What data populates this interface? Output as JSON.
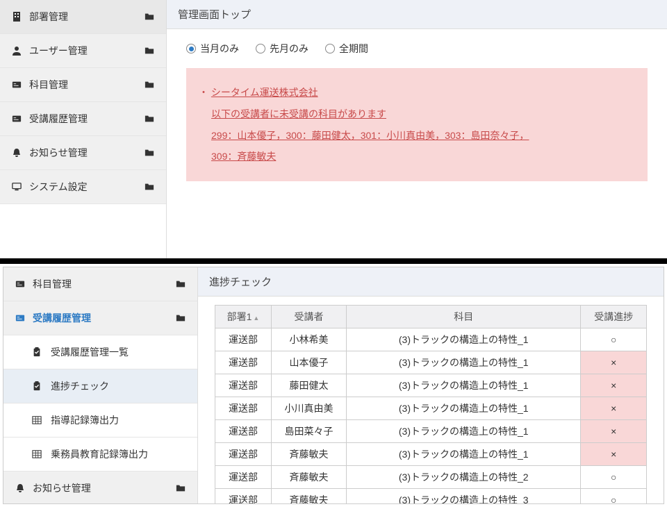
{
  "top": {
    "sidebar": [
      {
        "icon": "building",
        "label": "部署管理"
      },
      {
        "icon": "user",
        "label": "ユーザー管理"
      },
      {
        "icon": "card",
        "label": "科目管理"
      },
      {
        "icon": "card",
        "label": "受講履歴管理"
      },
      {
        "icon": "bell",
        "label": "お知らせ管理"
      },
      {
        "icon": "monitor",
        "label": "システム設定"
      }
    ],
    "page_title": "管理画面トップ",
    "radios": [
      {
        "label": "当月のみ",
        "selected": true
      },
      {
        "label": "先月のみ",
        "selected": false
      },
      {
        "label": "全期間",
        "selected": false
      }
    ],
    "alert": {
      "company": "シータイム運送株式会社",
      "line1": "以下の受講者に未受講の科目があります",
      "line2": "299：山本優子，300：藤田健太，301：小川真由美，303：島田奈々子，",
      "line3": "309：斉藤敏夫"
    }
  },
  "bottom": {
    "sidebar": {
      "item_subject": "科目管理",
      "item_history": "受講履歴管理",
      "sub_list": "受講履歴管理一覧",
      "sub_progress": "進捗チェック",
      "sub_export1": "指導記録簿出力",
      "sub_export2": "乗務員教育記録簿出力",
      "item_notice": "お知らせ管理"
    },
    "page_title": "進捗チェック",
    "table": {
      "headers": {
        "dept": "部署1",
        "user": "受講者",
        "subject": "科目",
        "progress": "受講進捗"
      },
      "rows": [
        {
          "dept": "運送部",
          "user": "小林希美",
          "subject": "(3)トラックの構造上の特性_1",
          "progress": "○",
          "fail": false
        },
        {
          "dept": "運送部",
          "user": "山本優子",
          "subject": "(3)トラックの構造上の特性_1",
          "progress": "×",
          "fail": true
        },
        {
          "dept": "運送部",
          "user": "藤田健太",
          "subject": "(3)トラックの構造上の特性_1",
          "progress": "×",
          "fail": true
        },
        {
          "dept": "運送部",
          "user": "小川真由美",
          "subject": "(3)トラックの構造上の特性_1",
          "progress": "×",
          "fail": true
        },
        {
          "dept": "運送部",
          "user": "島田菜々子",
          "subject": "(3)トラックの構造上の特性_1",
          "progress": "×",
          "fail": true
        },
        {
          "dept": "運送部",
          "user": "斉藤敏夫",
          "subject": "(3)トラックの構造上の特性_1",
          "progress": "×",
          "fail": true
        },
        {
          "dept": "運送部",
          "user": "斉藤敏夫",
          "subject": "(3)トラックの構造上の特性_2",
          "progress": "○",
          "fail": false
        },
        {
          "dept": "運送部",
          "user": "斉藤敏夫",
          "subject": "(3)トラックの構造上の特性_3",
          "progress": "○",
          "fail": false
        }
      ]
    }
  }
}
